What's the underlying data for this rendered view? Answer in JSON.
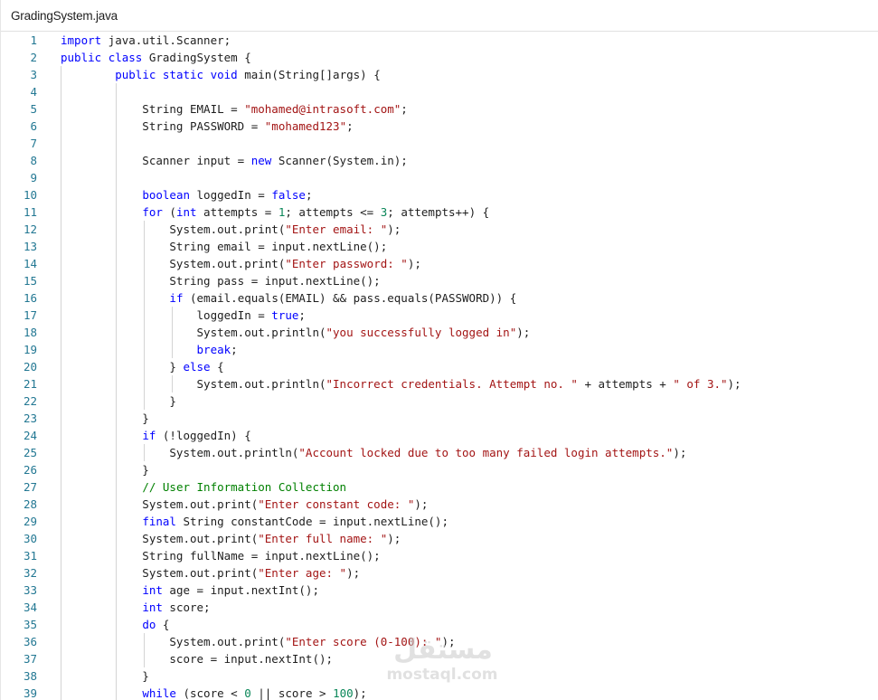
{
  "tab": {
    "filename": "GradingSystem.java"
  },
  "watermark": {
    "arabic": "مستقل",
    "latin": "mostaql.com"
  },
  "colors": {
    "keyword": "#0000ff",
    "string": "#a31515",
    "number": "#098658",
    "comment": "#008000",
    "line_number": "#237893",
    "text": "#1e1e1e"
  },
  "lines": [
    {
      "n": "1",
      "t": [
        [
          "kw",
          "import"
        ],
        [
          "pl",
          " java.util.Scanner;"
        ]
      ]
    },
    {
      "n": "2",
      "t": [
        [
          "kw",
          "public"
        ],
        [
          "pl",
          " "
        ],
        [
          "kw",
          "class"
        ],
        [
          "pl",
          " GradingSystem {"
        ]
      ]
    },
    {
      "n": "3",
      "t": [
        [
          "pl",
          "        "
        ],
        [
          "kw",
          "public"
        ],
        [
          "pl",
          " "
        ],
        [
          "kw",
          "static"
        ],
        [
          "pl",
          " "
        ],
        [
          "kw",
          "void"
        ],
        [
          "pl",
          " main(String[]args) {"
        ]
      ]
    },
    {
      "n": "4",
      "t": []
    },
    {
      "n": "5",
      "t": [
        [
          "pl",
          "            String EMAIL = "
        ],
        [
          "str",
          "\"mohamed@intrasoft.com\""
        ],
        [
          "pl",
          ";"
        ]
      ]
    },
    {
      "n": "6",
      "t": [
        [
          "pl",
          "            String PASSWORD = "
        ],
        [
          "str",
          "\"mohamed123\""
        ],
        [
          "pl",
          ";"
        ]
      ]
    },
    {
      "n": "7",
      "t": []
    },
    {
      "n": "8",
      "t": [
        [
          "pl",
          "            Scanner input = "
        ],
        [
          "kw",
          "new"
        ],
        [
          "pl",
          " Scanner(System.in);"
        ]
      ]
    },
    {
      "n": "9",
      "t": []
    },
    {
      "n": "10",
      "t": [
        [
          "pl",
          "            "
        ],
        [
          "kw",
          "boolean"
        ],
        [
          "pl",
          " loggedIn = "
        ],
        [
          "kw",
          "false"
        ],
        [
          "pl",
          ";"
        ]
      ]
    },
    {
      "n": "11",
      "t": [
        [
          "pl",
          "            "
        ],
        [
          "kw",
          "for"
        ],
        [
          "pl",
          " ("
        ],
        [
          "kw",
          "int"
        ],
        [
          "pl",
          " attempts = "
        ],
        [
          "num",
          "1"
        ],
        [
          "pl",
          "; attempts <= "
        ],
        [
          "num",
          "3"
        ],
        [
          "pl",
          "; attempts++) {"
        ]
      ]
    },
    {
      "n": "12",
      "t": [
        [
          "pl",
          "                System.out.print("
        ],
        [
          "str",
          "\"Enter email: \""
        ],
        [
          "pl",
          ");"
        ]
      ]
    },
    {
      "n": "13",
      "t": [
        [
          "pl",
          "                String email = input.nextLine();"
        ]
      ]
    },
    {
      "n": "14",
      "t": [
        [
          "pl",
          "                System.out.print("
        ],
        [
          "str",
          "\"Enter password: \""
        ],
        [
          "pl",
          ");"
        ]
      ]
    },
    {
      "n": "15",
      "t": [
        [
          "pl",
          "                String pass = input.nextLine();"
        ]
      ]
    },
    {
      "n": "16",
      "t": [
        [
          "pl",
          "                "
        ],
        [
          "kw",
          "if"
        ],
        [
          "pl",
          " (email.equals(EMAIL) && pass.equals(PASSWORD)) {"
        ]
      ]
    },
    {
      "n": "17",
      "t": [
        [
          "pl",
          "                    loggedIn = "
        ],
        [
          "kw",
          "true"
        ],
        [
          "pl",
          ";"
        ]
      ]
    },
    {
      "n": "18",
      "t": [
        [
          "pl",
          "                    System.out.println("
        ],
        [
          "str",
          "\"you successfully logged in\""
        ],
        [
          "pl",
          ");"
        ]
      ]
    },
    {
      "n": "19",
      "t": [
        [
          "pl",
          "                    "
        ],
        [
          "kw",
          "break"
        ],
        [
          "pl",
          ";"
        ]
      ]
    },
    {
      "n": "20",
      "t": [
        [
          "pl",
          "                } "
        ],
        [
          "kw",
          "else"
        ],
        [
          "pl",
          " {"
        ]
      ]
    },
    {
      "n": "21",
      "t": [
        [
          "pl",
          "                    System.out.println("
        ],
        [
          "str",
          "\"Incorrect credentials. Attempt no. \""
        ],
        [
          "pl",
          " + attempts + "
        ],
        [
          "str",
          "\" of 3.\""
        ],
        [
          "pl",
          ");"
        ]
      ]
    },
    {
      "n": "22",
      "t": [
        [
          "pl",
          "                }"
        ]
      ]
    },
    {
      "n": "23",
      "t": [
        [
          "pl",
          "            }"
        ]
      ]
    },
    {
      "n": "24",
      "t": [
        [
          "pl",
          "            "
        ],
        [
          "kw",
          "if"
        ],
        [
          "pl",
          " (!loggedIn) {"
        ]
      ]
    },
    {
      "n": "25",
      "t": [
        [
          "pl",
          "                System.out.println("
        ],
        [
          "str",
          "\"Account locked due to too many failed login attempts.\""
        ],
        [
          "pl",
          ");"
        ]
      ]
    },
    {
      "n": "26",
      "t": [
        [
          "pl",
          "            }"
        ]
      ]
    },
    {
      "n": "27",
      "t": [
        [
          "pl",
          "            "
        ],
        [
          "cm",
          "// User Information Collection"
        ]
      ]
    },
    {
      "n": "28",
      "t": [
        [
          "pl",
          "            System.out.print("
        ],
        [
          "str",
          "\"Enter constant code: \""
        ],
        [
          "pl",
          ");"
        ]
      ]
    },
    {
      "n": "29",
      "t": [
        [
          "pl",
          "            "
        ],
        [
          "kw",
          "final"
        ],
        [
          "pl",
          " String constantCode = input.nextLine();"
        ]
      ]
    },
    {
      "n": "30",
      "t": [
        [
          "pl",
          "            System.out.print("
        ],
        [
          "str",
          "\"Enter full name: \""
        ],
        [
          "pl",
          ");"
        ]
      ]
    },
    {
      "n": "31",
      "t": [
        [
          "pl",
          "            String fullName = input.nextLine();"
        ]
      ]
    },
    {
      "n": "32",
      "t": [
        [
          "pl",
          "            System.out.print("
        ],
        [
          "str",
          "\"Enter age: \""
        ],
        [
          "pl",
          ");"
        ]
      ]
    },
    {
      "n": "33",
      "t": [
        [
          "pl",
          "            "
        ],
        [
          "kw",
          "int"
        ],
        [
          "pl",
          " age = input.nextInt();"
        ]
      ]
    },
    {
      "n": "34",
      "t": [
        [
          "pl",
          "            "
        ],
        [
          "kw",
          "int"
        ],
        [
          "pl",
          " score;"
        ]
      ]
    },
    {
      "n": "35",
      "t": [
        [
          "pl",
          "            "
        ],
        [
          "kw",
          "do"
        ],
        [
          "pl",
          " {"
        ]
      ]
    },
    {
      "n": "36",
      "t": [
        [
          "pl",
          "                System.out.print("
        ],
        [
          "str",
          "\"Enter score (0-100): \""
        ],
        [
          "pl",
          ");"
        ]
      ]
    },
    {
      "n": "37",
      "t": [
        [
          "pl",
          "                score = input.nextInt();"
        ]
      ]
    },
    {
      "n": "38",
      "t": [
        [
          "pl",
          "            }"
        ]
      ]
    },
    {
      "n": "39",
      "t": [
        [
          "pl",
          "            "
        ],
        [
          "kw",
          "while"
        ],
        [
          "pl",
          " (score < "
        ],
        [
          "num",
          "0"
        ],
        [
          "pl",
          " || score > "
        ],
        [
          "num",
          "100"
        ],
        [
          "pl",
          ");"
        ]
      ]
    }
  ]
}
